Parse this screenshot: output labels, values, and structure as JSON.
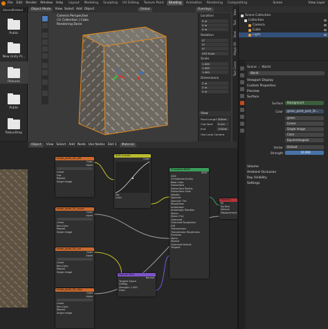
{
  "menu": [
    "File",
    "Edit",
    "Render",
    "Window",
    "Help"
  ],
  "workspaces": [
    "Layout",
    "Modeling",
    "Sculpting",
    "UV Editing",
    "Texture Paint",
    "Shading",
    "Animation",
    "Rendering",
    "Compositing"
  ],
  "active_workspace": "Shading",
  "scene_name": "Scene",
  "view_layer": "View Layer",
  "file_browser": {
    "path": "/Users/Kirsten/",
    "items": [
      {
        "label": "Public"
      },
      {
        "label": "New Unity Pr..."
      },
      {
        "label": "Pictures"
      },
      {
        "label": "Public"
      },
      {
        "label": "RebusDrop"
      }
    ]
  },
  "viewport": {
    "mode": "Object Mode",
    "view": "View",
    "select": "Select",
    "add": "Add",
    "object": "Object",
    "shading": "Global",
    "overlays": "Overlays",
    "info": [
      "Camera Perspective",
      "(1) Collection | Cube",
      "Rendering Done"
    ],
    "npanel": {
      "location_label": "Location",
      "location": [
        "0 m",
        "0 m",
        "0 m"
      ],
      "rotation_label": "Rotation",
      "rotation": [
        "0°",
        "0°",
        "0°"
      ],
      "rotation_mode": "XYZ Euler",
      "scale_label": "Scale",
      "scale": [
        "1.000",
        "1.000",
        "1.000"
      ],
      "dimensions_label": "Dimensions",
      "dimensions": [
        "2 m",
        "2 m",
        "2 m"
      ],
      "view_section": "View",
      "focal_length_label": "Focal Length",
      "focal_length": "50mm",
      "clip_start_label": "Clip Start",
      "clip_start": "0.1m",
      "end_label": "End",
      "end": "1000m",
      "local_camera": "Use Local Camera",
      "axis_labels": [
        "X",
        "Y",
        "Z"
      ]
    },
    "side_tabs": [
      "Item",
      "Tool",
      "View",
      "Magic UV",
      "Text Curve"
    ]
  },
  "node_editor": {
    "header": [
      "Object",
      "View",
      "Select",
      "Add",
      "Node",
      "Use Nodes",
      "Material"
    ],
    "slot_label": "Slot 1",
    "material_label": "Material",
    "nodes": {
      "tex1": {
        "title": "metal_plate_04_diff",
        "rows": [
          "Color",
          "Alpha",
          "Linear",
          "Flat",
          "Repeat",
          "Single Image"
        ]
      },
      "tex2": {
        "title": "metal_plate_04_rough",
        "rows": [
          "Color",
          "Alpha",
          "Linear",
          "Non-Color",
          "Repeat",
          "Single Image"
        ]
      },
      "tex3": {
        "title": "metal_plate_04_nor",
        "rows": [
          "Color",
          "Alpha",
          "Linear",
          "Non-Color",
          "Repeat",
          "Single Image"
        ]
      },
      "tex4": {
        "title": "metal_plate_04_disp",
        "rows": [
          "Color",
          "Alpha",
          "Linear",
          "Non-Color",
          "Repeat",
          "Single Image"
        ]
      },
      "curves": {
        "title": "RGB Curves",
        "rows": [
          "Color",
          "Fac",
          "Color"
        ]
      },
      "bsdf": {
        "title": "Principled BSDF",
        "rows": [
          "BSDF",
          "GGX",
          "Christensen-Burley",
          "Base Color",
          "Subsurface",
          "Subsurface Radius",
          "Subsurface Color",
          "Metallic",
          "Specular",
          "Specular Tint",
          "Roughness",
          "Anisotropic",
          "Anisotropic Rotation",
          "Sheen",
          "Sheen Tint",
          "Clearcoat",
          "Clearcoat Roughness",
          "IOR",
          "Transmission",
          "Transmission Roughness",
          "Emission",
          "Alpha",
          "Normal",
          "Clearcoat Normal",
          "Tangent"
        ]
      },
      "output": {
        "title": "Material Output",
        "rows": [
          "All",
          "Surface",
          "Volume",
          "Displacement"
        ]
      },
      "normal": {
        "title": "Normal Map",
        "rows": [
          "Normal",
          "Tangent Space",
          "UVMap",
          "Strength: 1.000",
          "Color"
        ]
      }
    }
  },
  "outliner": {
    "rows": [
      {
        "label": "Scene Collection",
        "indent": 0
      },
      {
        "label": "Collection",
        "indent": 1
      },
      {
        "label": "Camera",
        "indent": 2
      },
      {
        "label": "Cube",
        "indent": 2
      },
      {
        "label": "Light",
        "indent": 2,
        "selected": true
      }
    ]
  },
  "properties": {
    "breadcrumb": "Scene",
    "world_tab": "World",
    "world_name": "World",
    "sections": [
      "Viewport Display",
      "Custom Properties",
      "Preview",
      "Surface"
    ],
    "surface_label": "Surface",
    "surface_value": "Background",
    "color_label": "Color",
    "color_value": "green_point_park_2k...",
    "image_name": "green",
    "image_rows": [
      "Linear",
      "Single Image",
      "Color",
      "Equirectangular"
    ],
    "vector_label": "Vector",
    "vector_value": "Default",
    "strength_label": "Strength",
    "strength_value": "10.000",
    "bottom_sections": [
      "Volume",
      "Ambient Occlusion",
      "Ray Visibility",
      "Settings"
    ]
  },
  "colors": {
    "accent_blue": "#4873a8",
    "texture_header": "#c8692e",
    "shader_header": "#3a9c5b",
    "output_header": "#b7353b"
  }
}
